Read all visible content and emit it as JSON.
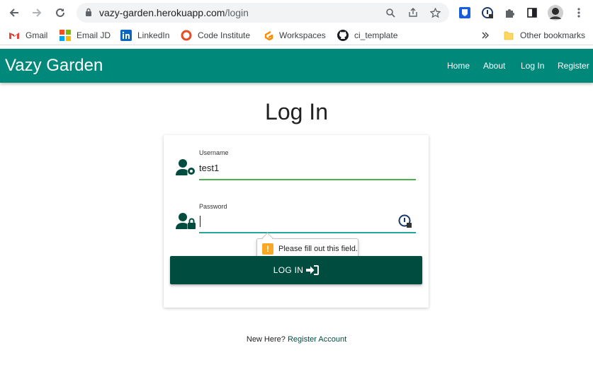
{
  "browser": {
    "url_host": "vazy-garden.herokuapp.com",
    "url_path": "/login"
  },
  "bookmarks": [
    {
      "label": "Gmail",
      "icon": "gmail-icon"
    },
    {
      "label": "Email JD",
      "icon": "microsoft-icon"
    },
    {
      "label": "LinkedIn",
      "icon": "linkedin-icon"
    },
    {
      "label": "Code Institute",
      "icon": "code-institute-icon"
    },
    {
      "label": "Workspaces",
      "icon": "gitpod-icon"
    },
    {
      "label": "ci_template",
      "icon": "github-icon"
    }
  ],
  "bookmarks_other": "Other bookmarks",
  "navbar": {
    "brand": "Vazy Garden",
    "links": [
      "Home",
      "About",
      "Log In",
      "Register"
    ]
  },
  "page": {
    "title": "Log In",
    "username_label": "Username",
    "username_value": "test1",
    "password_label": "Password",
    "tooltip": "Please fill out this field.",
    "login_button": "LOG IN",
    "footer_prefix": "New Here?",
    "footer_link": "Register Account"
  },
  "colors": {
    "navbar": "#00897b",
    "button": "#004d40",
    "active_underline": "#4caf50",
    "focus_underline": "#26a69a"
  }
}
